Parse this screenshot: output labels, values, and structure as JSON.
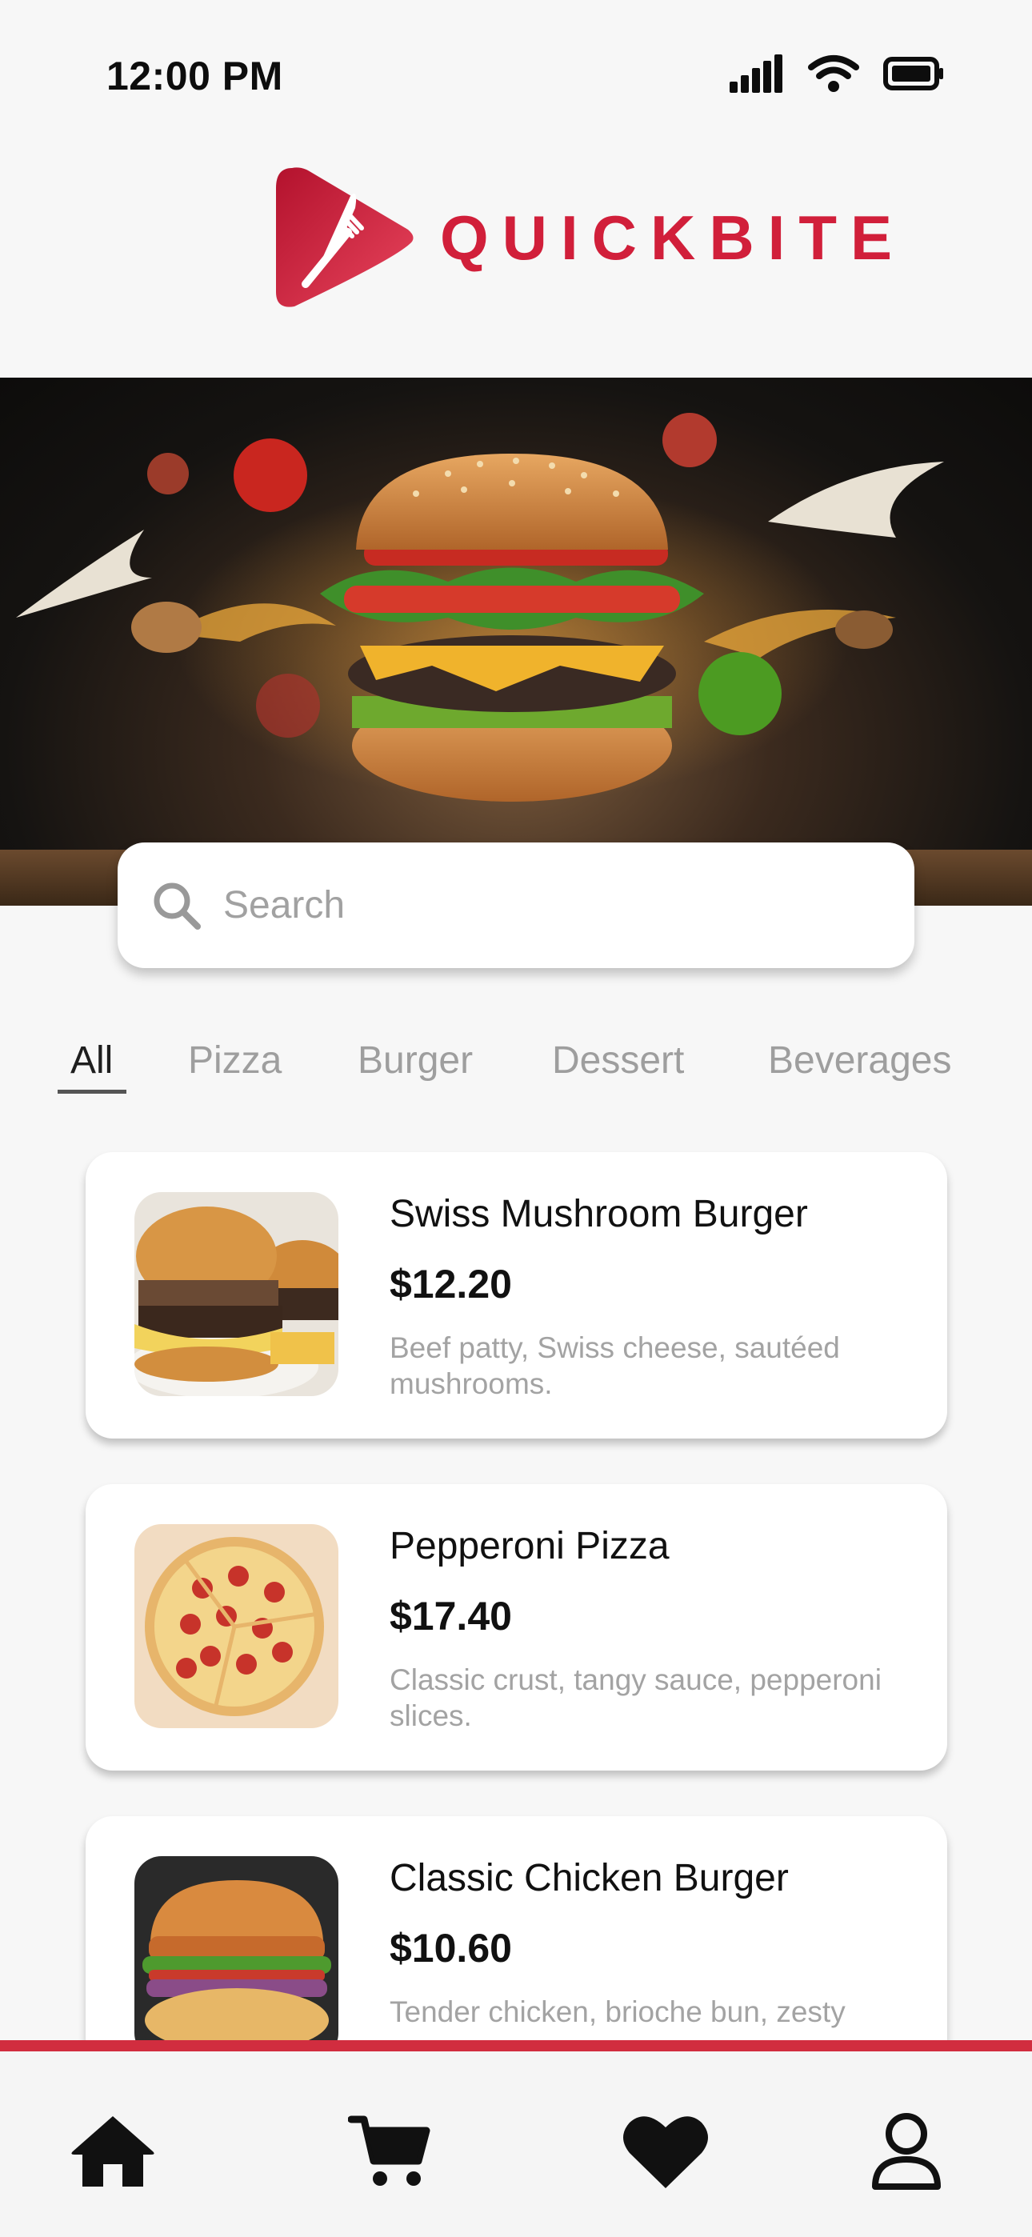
{
  "status_bar": {
    "time": "12:00 PM"
  },
  "app": {
    "logo_text": "QUICKBITE",
    "brand_color": "#d11f3a"
  },
  "search": {
    "placeholder": "Search",
    "icon": "search-icon"
  },
  "categories": [
    {
      "label": "All",
      "active": true
    },
    {
      "label": "Pizza",
      "active": false
    },
    {
      "label": "Burger",
      "active": false
    },
    {
      "label": "Dessert",
      "active": false
    },
    {
      "label": "Beverages",
      "active": false
    }
  ],
  "menu_items": [
    {
      "name": "Swiss Mushroom Burger",
      "price": "$12.20",
      "description": "Beef patty, Swiss cheese, sautéed mushrooms."
    },
    {
      "name": "Pepperoni Pizza",
      "price": "$17.40",
      "description": "Classic crust, tangy sauce, pepperoni slices."
    },
    {
      "name": "Classic Chicken Burger",
      "price": "$10.60",
      "description": "Tender chicken, brioche bun, zesty"
    }
  ],
  "bottom_nav": {
    "items": [
      {
        "icon": "home-icon"
      },
      {
        "icon": "cart-icon"
      },
      {
        "icon": "heart-icon"
      },
      {
        "icon": "profile-icon"
      }
    ],
    "accent_color": "#d12d3f"
  }
}
